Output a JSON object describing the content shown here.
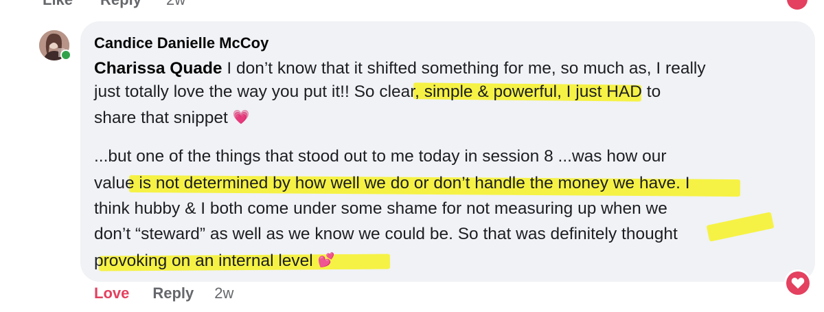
{
  "top_bar": {
    "like_label": "Like",
    "reply_label": "Reply",
    "timestamp": "2w"
  },
  "comment": {
    "author": "Candice Danielle McCoy",
    "mention": "Charissa Quade",
    "lines": [
      " I don’t know that it shifted something for me, so much as, I really",
      "just totally love the way you put it!! So clear, simple & powerful, I just HAD to",
      "share that snippet ",
      "...but one of the things that stood out to me today in session 8 ...was how our",
      "value is not determined by how well we do or don’t handle the money we have. I",
      "think hubby & I both come under some shame for not measuring up when we",
      "don’t “steward” as well as we know we could be. So that was definitely thought",
      "provoking on an internal level "
    ],
    "highlight_color": "#f6f11f"
  },
  "actions": {
    "love_label": "Love",
    "reply_label": "Reply",
    "timestamp": "2w"
  },
  "reaction": {
    "icon": "heart-icon",
    "color": "#e4405f"
  },
  "avatar": {
    "status": "online",
    "status_color": "#31a24c"
  }
}
